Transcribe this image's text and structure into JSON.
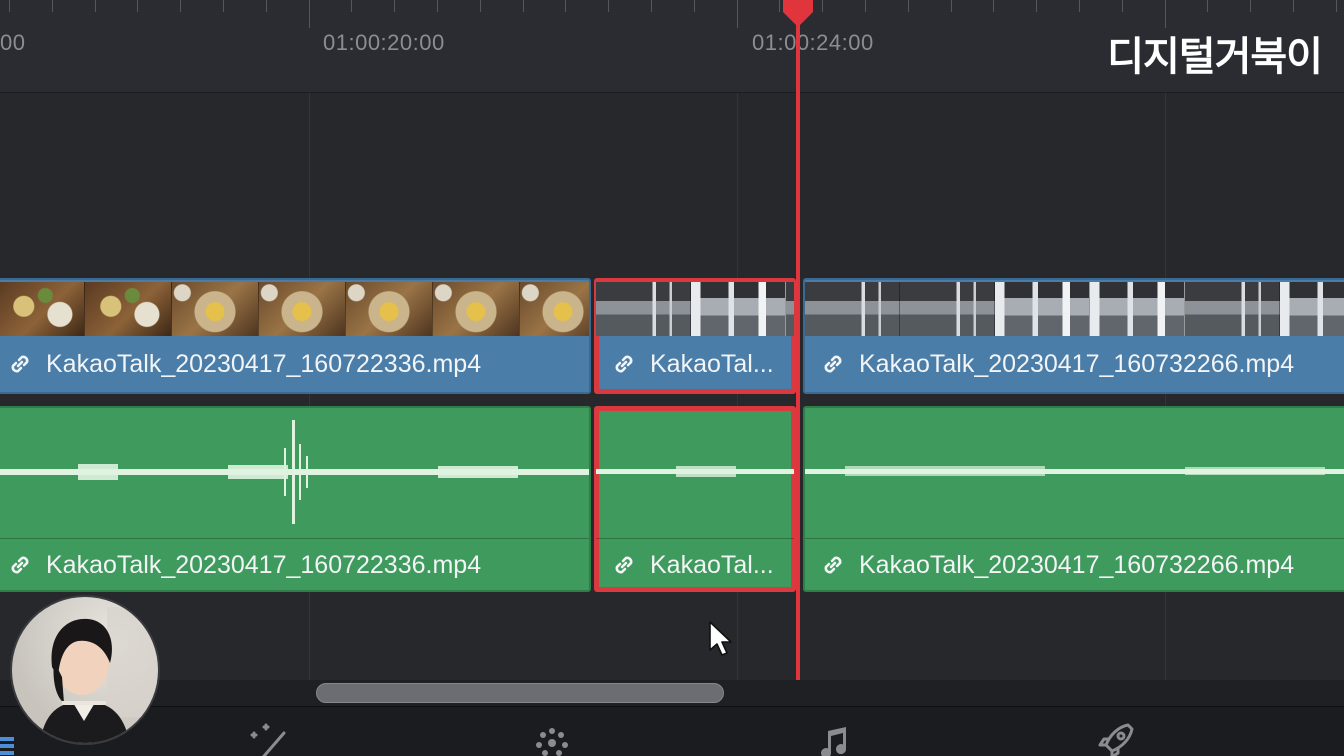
{
  "ruler": {
    "timecodes": [
      "00",
      "01:00:20:00",
      "01:00:24:00"
    ]
  },
  "watermark": "디지털거북이",
  "clips": {
    "video": [
      {
        "name": "KakaoTalk_20230417_160722336.mp4",
        "linked": false,
        "selected": false
      },
      {
        "name": "KakaoTal...",
        "linked": true,
        "selected": true
      },
      {
        "name": "KakaoTalk_20230417_160732266.mp4",
        "linked": true,
        "selected": false
      }
    ],
    "audio": [
      {
        "name": "KakaoTalk_20230417_160722336.mp4",
        "linked": false,
        "selected": false
      },
      {
        "name": "KakaoTal...",
        "linked": true,
        "selected": true
      },
      {
        "name": "KakaoTalk_20230417_160732266.mp4",
        "linked": true,
        "selected": false
      }
    ]
  },
  "colors": {
    "video_clip": "#4a7da8",
    "audio_clip": "#3f9a5d",
    "playhead": "#e0353d",
    "selection": "#d9393f",
    "waveform": "#dff3e0"
  },
  "bottom_bar": {
    "pages": [
      "edit-page-icon",
      "fusion-page-icon",
      "color-page-icon",
      "fairlight-page-icon",
      "deliver-page-icon"
    ]
  }
}
